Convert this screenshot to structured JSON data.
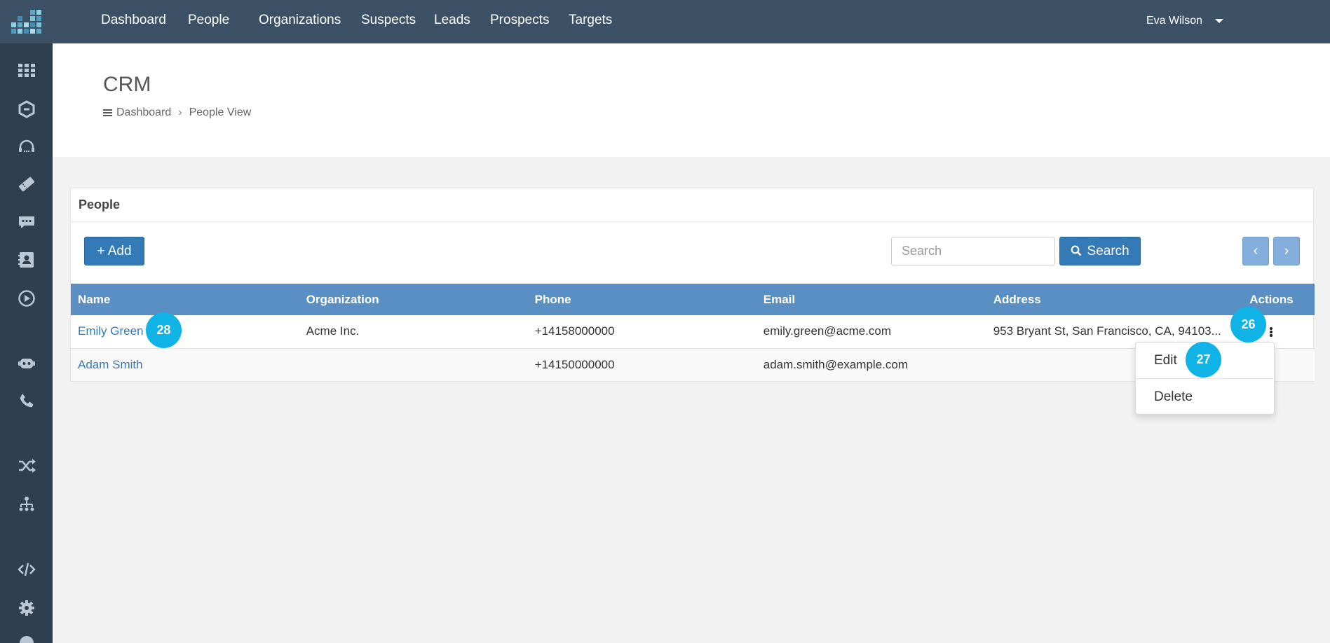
{
  "colors": {
    "topbar": "#3d5166",
    "sidebar": "#2f3f4f",
    "primary": "#337ab7",
    "table_header": "#5a8fc4",
    "badge": "#0fb3e6"
  },
  "sidebar": {
    "icons": [
      "apps-grid-icon",
      "hexagon-icon",
      "headset-icon",
      "ticket-icon",
      "chat-icon",
      "contact-card-icon",
      "play-icon",
      "bot-icon",
      "phone-icon",
      "shuffle-icon",
      "network-icon",
      "code-icon",
      "settings-icon",
      "globe-icon"
    ]
  },
  "topnav": {
    "items": [
      "Dashboard",
      "People",
      "Organizations",
      "Suspects",
      "Leads",
      "Prospects",
      "Targets"
    ],
    "user": "Eva Wilson"
  },
  "header": {
    "title": "CRM",
    "breadcrumb": [
      "Dashboard",
      "People View"
    ]
  },
  "panel": {
    "title": "People",
    "add_label": "+ Add",
    "search_placeholder": "Search",
    "search_label": "Search",
    "prev_label": "‹",
    "next_label": "›"
  },
  "table": {
    "columns": [
      "Name",
      "Organization",
      "Phone",
      "Email",
      "Address",
      "Actions"
    ],
    "rows": [
      {
        "name": "Emily Green",
        "organization": "Acme Inc.",
        "phone": "+14158000000",
        "email": "emily.green@acme.com",
        "address": "953 Bryant St, San Francisco, CA, 94103..."
      },
      {
        "name": "Adam Smith",
        "organization": "",
        "phone": "+14150000000",
        "email": "adam.smith@example.com",
        "address": ""
      }
    ]
  },
  "dropdown": {
    "items": [
      "Edit",
      "Delete"
    ]
  },
  "badges": [
    "28",
    "26",
    "27"
  ]
}
